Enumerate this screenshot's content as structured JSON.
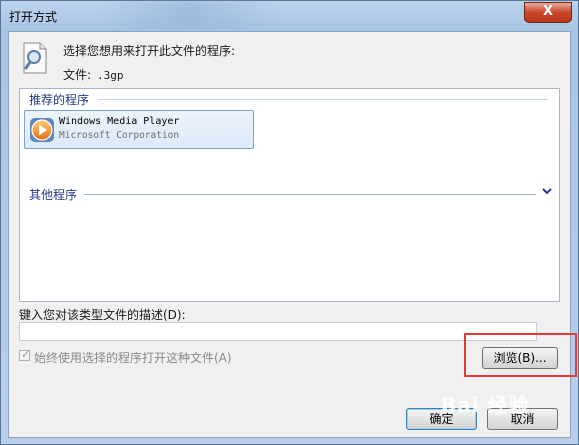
{
  "window": {
    "title": "打开方式",
    "close_label": "X"
  },
  "header": {
    "prompt": "选择您想用来打开此文件的程序:",
    "file_label": "文件:",
    "file_ext": ".3gp",
    "file_icon": "search-document-icon"
  },
  "programs": {
    "recommended_header": "推荐的程序",
    "other_header": "其他程序",
    "items": [
      {
        "name": "Windows Media Player",
        "publisher": "Microsoft Corporation",
        "icon": "windows-media-player-icon"
      }
    ]
  },
  "description": {
    "label": "键入您对该类型文件的描述(D):",
    "value": ""
  },
  "always_use": {
    "label": "始终使用选择的程序打开这种文件(A)",
    "checked": true,
    "enabled": false
  },
  "buttons": {
    "browse": "浏览(B)...",
    "ok": "确定",
    "cancel": "取消"
  },
  "annotation_color": "#e53935",
  "watermark": "Bai 经验"
}
